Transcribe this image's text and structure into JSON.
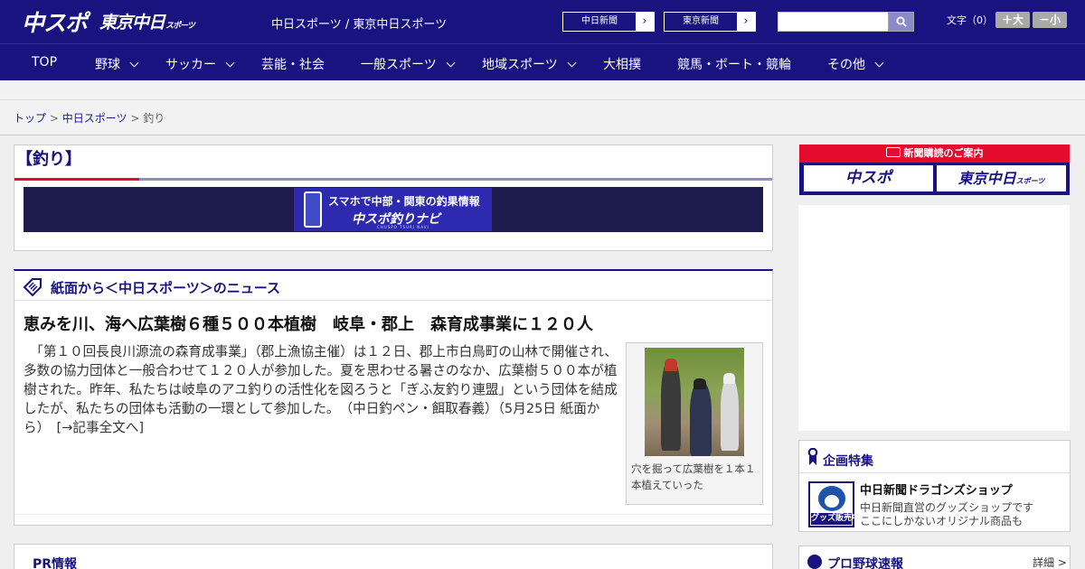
{
  "header": {
    "logo_chusupo": "中スポ",
    "logo_tokyo_main": "東京中日",
    "logo_tokyo_sub": "スポーツ",
    "site_name": "中日スポーツ / 東京中日スポーツ",
    "link_chunichi": "中日新聞",
    "link_tokyo": "東京新聞",
    "link_arrow": "›",
    "search_placeholder": "",
    "textsize_label": "文字（0）",
    "textsize_plus": "＋大",
    "textsize_minus": "－小"
  },
  "nav": {
    "items": [
      {
        "label": "TOP"
      },
      {
        "label": "野球"
      },
      {
        "label": "サッカー"
      },
      {
        "label": "芸能・社会"
      },
      {
        "label": "一般スポーツ"
      },
      {
        "label": "地域スポーツ"
      },
      {
        "label": "大相撲"
      },
      {
        "label": "競馬・ボート・競輪"
      },
      {
        "label": "その他"
      }
    ]
  },
  "breadcrumb": {
    "home": "トップ",
    "section": "中日スポーツ",
    "current": "釣り",
    "separator": ">"
  },
  "page": {
    "title": "【釣り】"
  },
  "banner": {
    "line1": "スマホで中部・関東の釣果情報",
    "line2": "中スポ釣りナビ",
    "line3": "CHUSPO TSURI NAVI"
  },
  "news": {
    "heading": "紙面から＜中日スポーツ＞のニュース",
    "article_title": "恵みを川、海へ広葉樹６種５００本植樹　岐阜・郡上　森育成事業に１２０人",
    "article_body": "　「第１０回長良川源流の森育成事業」（郡上漁協主催）は１２日、郡上市白鳥町の山林で開催され、多数の協力団体と一般合わせて１２０人が参加した。夏を思わせる暑さのなか、広葉樹５００本が植樹された。昨年、私たちは岐阜のアユ釣りの活性化を図ろうと「ぎふ友釣り連盟」という団体を結成したが、私たちの団体も活動の一環として参加した。　（中日釣ペン・餌取春義）（5月25日 紙面から）",
    "read_more": "[→記事全文へ]",
    "photo_caption": "穴を掘って広葉樹を１本１本植えていった"
  },
  "pr": {
    "label": "PR情報"
  },
  "subscribe": {
    "head": "新聞購読のご案内",
    "chusupo": "中スポ",
    "tokyo_main": "東京中日",
    "tokyo_sub": "スポーツ"
  },
  "feature": {
    "heading": "企画特集",
    "thumb_label": "グッズ販売中",
    "shop_name": "中日新聞ドラゴンズショップ",
    "shop_desc1": "中日新聞直営のグッズショップです",
    "shop_desc2": "ここにしかないオリジナル商品も"
  },
  "baseball": {
    "heading": "プロ野球速報",
    "more": "詳細 >"
  },
  "colors": {
    "brand_navy": "#18137e",
    "accent_red": "#e40b2f",
    "accent_lavender": "#8c8bd0"
  },
  "icons": [
    "search-icon",
    "chevron-down-icon",
    "tag-icon",
    "ribbon-icon",
    "baseball-icon",
    "smartphone-icon",
    "newspaper-icon"
  ]
}
